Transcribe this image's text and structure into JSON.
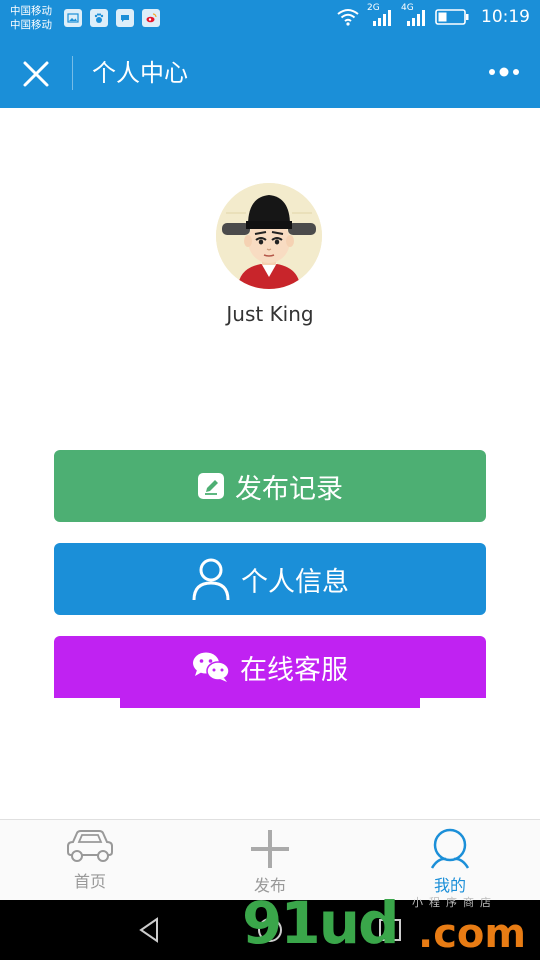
{
  "status_bar": {
    "carrier_1": "中国移动",
    "carrier_2": "中国移动",
    "network_1": "2G",
    "network_2": "4G",
    "time": "10:19"
  },
  "nav": {
    "title": "个人中心"
  },
  "profile": {
    "username": "Just King"
  },
  "menu": {
    "publish_label": "发布记录",
    "info_label": "个人信息",
    "service_label": "在线客服"
  },
  "tabs": [
    {
      "label": "首页",
      "icon": "car-icon",
      "active": false
    },
    {
      "label": "发布",
      "icon": "plus-icon",
      "active": false
    },
    {
      "label": "我的",
      "icon": "person-icon",
      "active": true
    }
  ],
  "watermark": {
    "main": "91ud",
    "suffix": ".com",
    "small": "小程序商店"
  },
  "colors": {
    "primary": "#1b8fd8",
    "publish": "#4daf73",
    "service": "#c022f2",
    "tab_inactive": "#999999"
  }
}
